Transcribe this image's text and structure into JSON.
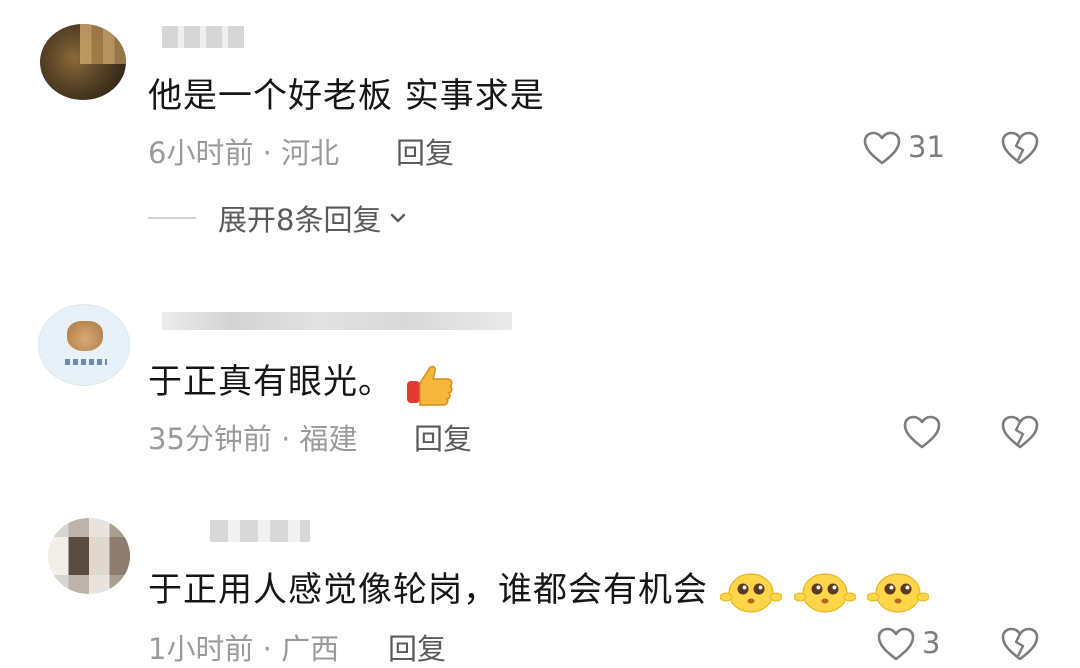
{
  "comments": [
    {
      "text": "他是一个好老板  实事求是",
      "time": "6小时前",
      "location": "河北",
      "meta": "6小时前 · 河北",
      "reply_label": "回复",
      "likes": "31",
      "expand_label": "展开8条回复"
    },
    {
      "text": "于正真有眼光。",
      "time": "35分钟前",
      "location": "福建",
      "meta": "35分钟前 · 福建",
      "reply_label": "回复",
      "likes": "",
      "emoji": "thumbs-up-emoji"
    },
    {
      "text": "于正用人感觉像轮岗，谁都会有机会",
      "time": "1小时前",
      "location": "广西",
      "meta": "1小时前 · 广西",
      "reply_label": "回复",
      "likes": "3",
      "emoji": "pleading-face-emoji"
    }
  ],
  "icons": {
    "like": "heart-outline-icon",
    "dislike": "broken-heart-icon",
    "expand": "chevron-down-icon"
  },
  "colors": {
    "text": "#161616",
    "meta": "#9b9b9b",
    "action": "#5a5a5a"
  }
}
